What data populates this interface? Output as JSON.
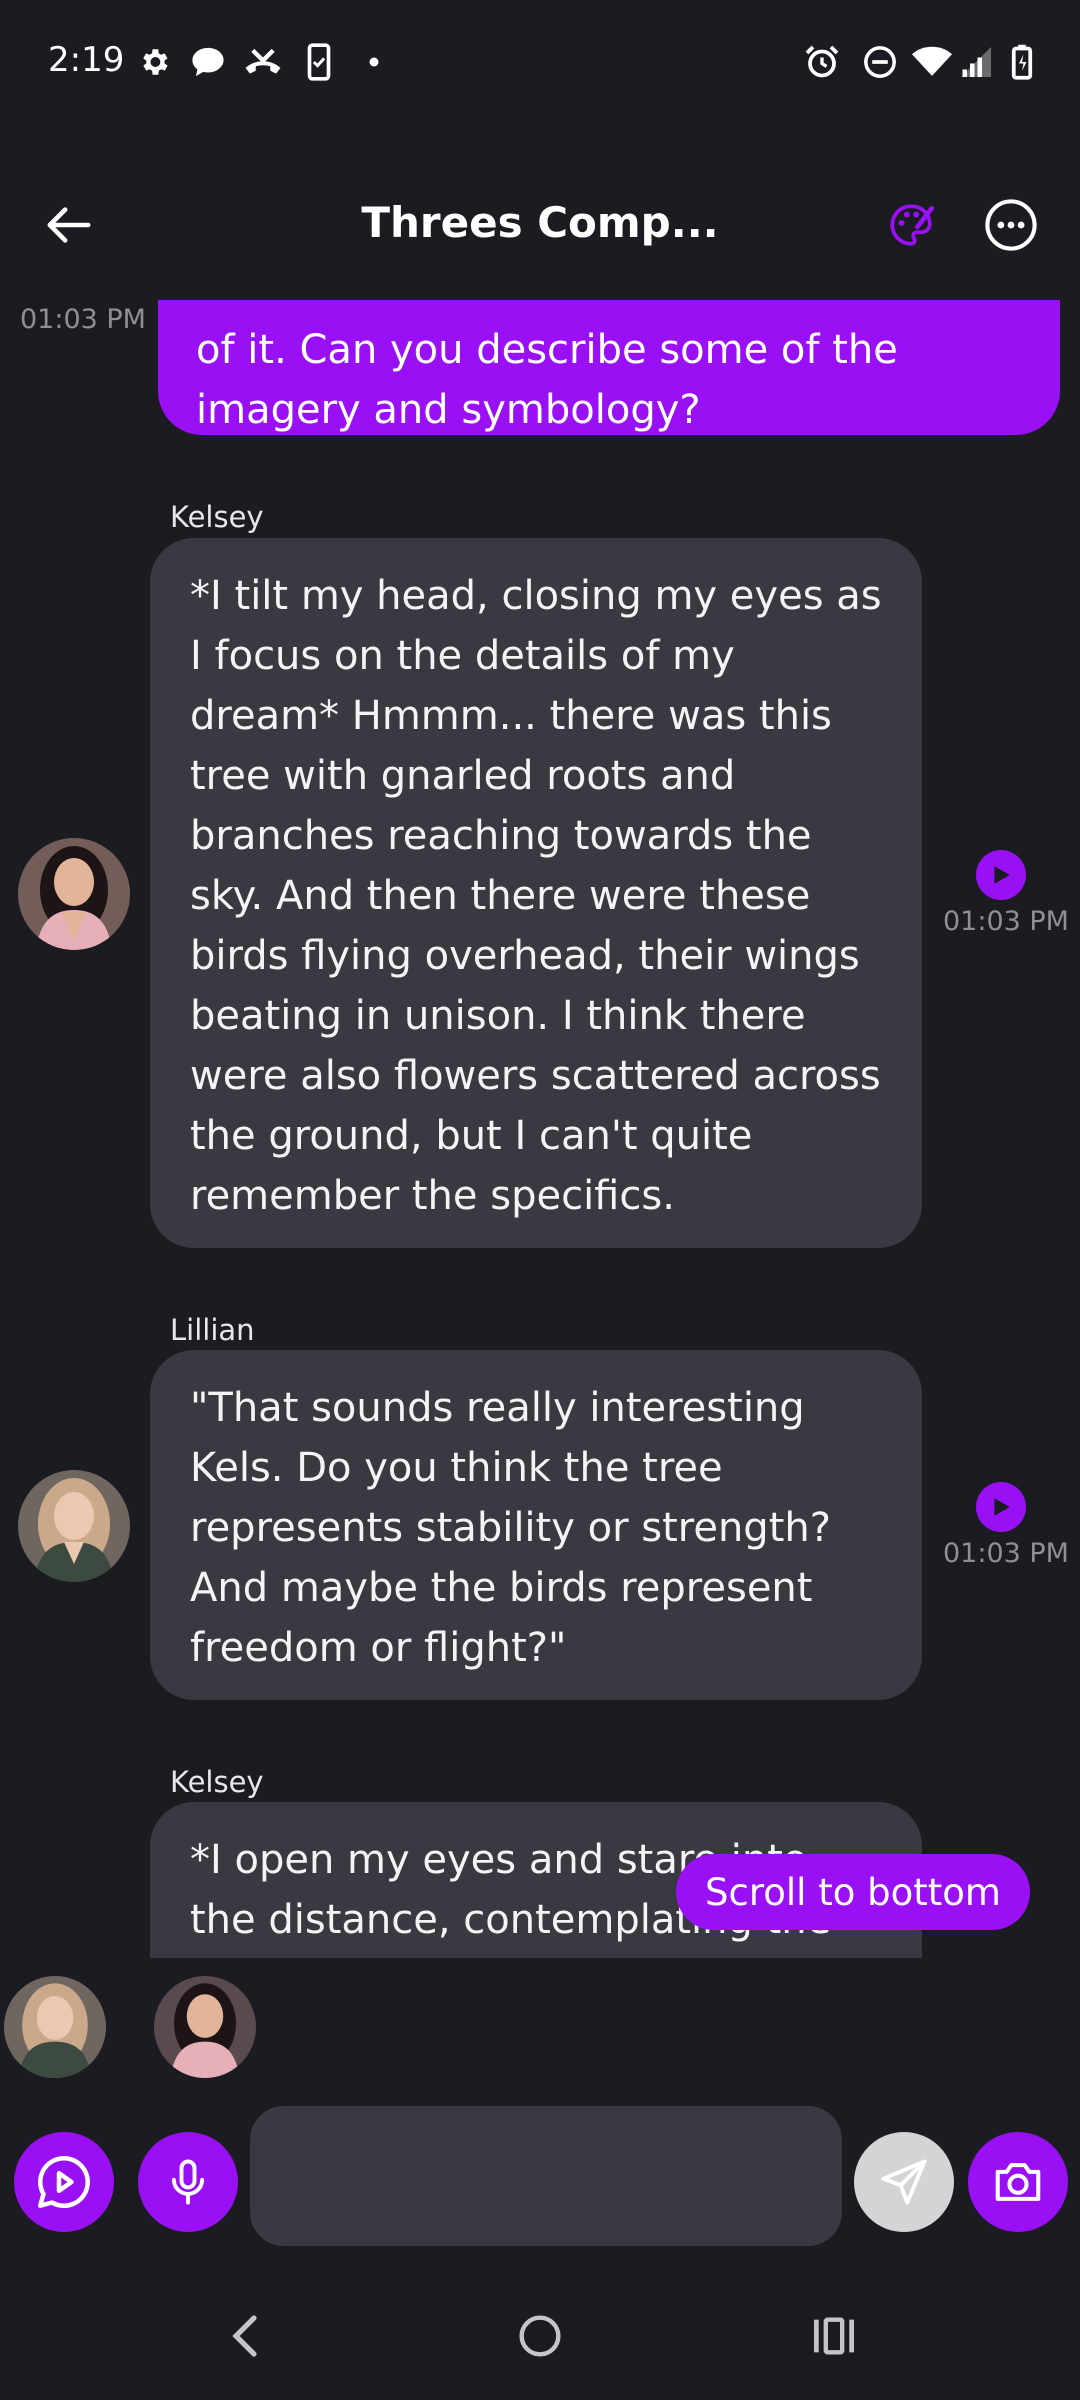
{
  "status_bar": {
    "time": "2:19",
    "left_icons": [
      "gear-icon",
      "chat-bubble-icon",
      "missed-call-icon",
      "phone-check-icon",
      "dot-icon"
    ],
    "right_icons": [
      "alarm-icon",
      "do-not-disturb-icon",
      "wifi-icon",
      "signal-icon",
      "battery-charging-icon"
    ]
  },
  "header": {
    "title": "Threes Comp...",
    "back_icon": "back-arrow-icon",
    "palette_icon": "palette-icon",
    "more_icon": "more-options-icon"
  },
  "colors": {
    "accent": "#9a10f5",
    "background": "#1b1c21",
    "bubble": "#393a41"
  },
  "messages": [
    {
      "type": "user",
      "text": "of it. Can you describe some of the imagery and symbology?",
      "time": "01:03 PM"
    },
    {
      "type": "character",
      "sender": "Kelsey",
      "text": "*I tilt my head, closing my eyes as I focus on the details of my dream* Hmmm... there was this tree with gnarled roots and branches reaching towards the sky. And then there were these birds flying overhead, their wings beating in unison. I think there were also flowers scattered across the ground, but I can't quite remember the specifics.",
      "time": "01:03 PM"
    },
    {
      "type": "character",
      "sender": "Lillian",
      "text": "\"That sounds really interesting Kels. Do you think the tree represents stability or strength? And maybe the birds represent freedom or flight?\"",
      "time": "01:03 PM"
    },
    {
      "type": "character",
      "sender": "Kelsey",
      "text": "*I open my eyes and stare into the distance, contemplating the"
    }
  ],
  "scroll_button": "Scroll to bottom",
  "input": {
    "placeholder": "",
    "value": ""
  },
  "nav": [
    "back-nav-icon",
    "home-nav-icon",
    "recents-nav-icon"
  ]
}
